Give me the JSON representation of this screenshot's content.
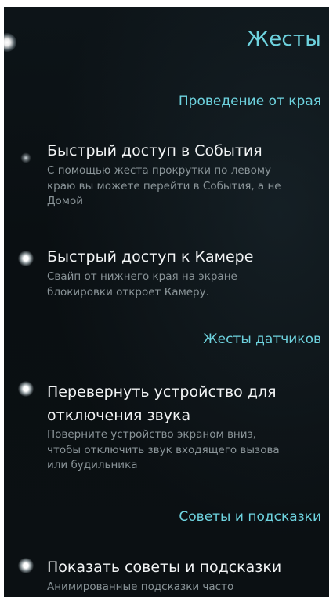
{
  "page": {
    "title": "Жесты"
  },
  "sections": [
    {
      "header": "Проведение от края",
      "items": [
        {
          "title": "Быстрый доступ в События",
          "description": "С помощью жеста прокрутки по левому краю вы можете перейти в События, а не Домой",
          "enabled": false
        },
        {
          "title": "Быстрый доступ к Камере",
          "description": "Свайп от нижнего края на экране блокировки откроет Камеру.",
          "enabled": true
        }
      ]
    },
    {
      "header": "Жесты датчиков",
      "items": [
        {
          "title": "Перевернуть устройство для отключения звука",
          "description": "Поверните устройство экраном вниз, чтобы отключить звук входящего вызова или будильника",
          "enabled": true
        }
      ]
    },
    {
      "header": "Советы и подсказки",
      "items": [
        {
          "title": "Показать советы и подсказки",
          "description": "Анимированные подсказки часто",
          "enabled": true
        }
      ]
    }
  ],
  "colors": {
    "accent": "#6ed3df",
    "primary_text": "#f2f4f5",
    "secondary_text": "#8a9498",
    "background": "#0b1013"
  }
}
